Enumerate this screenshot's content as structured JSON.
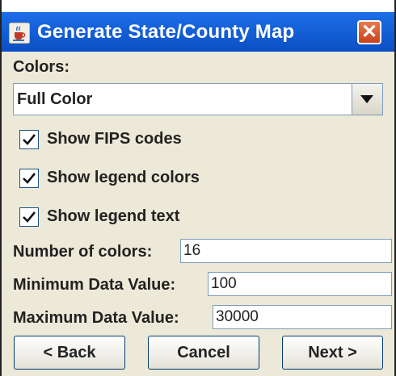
{
  "window": {
    "title": "Generate State/County Map",
    "icon": "java-cup-icon",
    "close_symbol": "✕"
  },
  "colors": {
    "label": "Colors:",
    "selected": "Full Color"
  },
  "options": [
    {
      "label": "Show FIPS codes",
      "checked": true
    },
    {
      "label": "Show legend colors",
      "checked": true
    },
    {
      "label": "Show legend text",
      "checked": true
    }
  ],
  "fields": {
    "num_colors": {
      "label": "Number of colors:",
      "value": "16"
    },
    "min_value": {
      "label": "Minimum Data Value:",
      "value": "100"
    },
    "max_value": {
      "label": "Maximum Data Value:",
      "value": "30000"
    }
  },
  "buttons": {
    "back": "< Back",
    "cancel": "Cancel",
    "next": "Next >"
  },
  "theme": {
    "titlebar": "#0b4fc4",
    "panel": "#ece9d8",
    "close": "#d2522a"
  }
}
